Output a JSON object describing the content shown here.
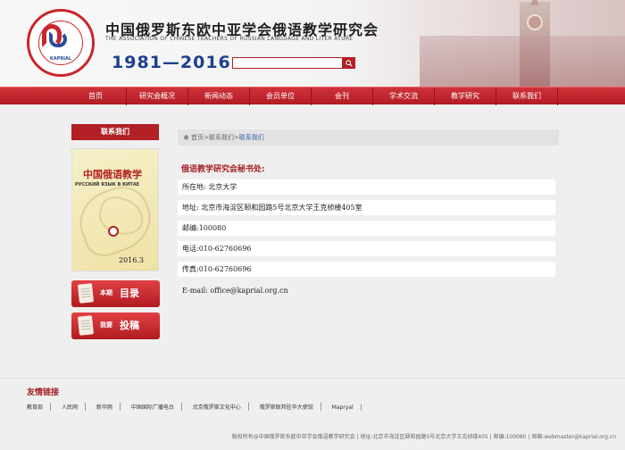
{
  "header": {
    "logo_text": "KAPRIAL",
    "title_cn": "中国俄罗斯东欧中亚学会俄语教学研究会",
    "title_en": "THE ASSOCIATION OF CHINESE TEACHERS OF RUSSIAN LANGUAGE AND LITER ATURE",
    "years": "1981—2016",
    "search": {
      "value": "",
      "placeholder": ""
    }
  },
  "nav": {
    "items": [
      {
        "label": "首页"
      },
      {
        "label": "研究会概况"
      },
      {
        "label": "新闻动态"
      },
      {
        "label": "会员单位"
      },
      {
        "label": "会刊"
      },
      {
        "label": "学术交流"
      },
      {
        "label": "教学研究"
      },
      {
        "label": "联系我们"
      }
    ]
  },
  "sidebar": {
    "title": "联系我们",
    "cover": {
      "title": "中国俄语教学",
      "subtitle": "РУССКИЙ ЯЗЫК В КИТАЕ",
      "date": "2016.3"
    },
    "btn_toc": {
      "small": "本期",
      "large": "目录"
    },
    "btn_submit": {
      "small": "我要",
      "large": "投稿"
    }
  },
  "breadcrumb": {
    "home": "首页",
    "sep1": ">",
    "section": "联系我们",
    "sep2": ">",
    "current": "联系我们"
  },
  "content": {
    "title": "俄语教学研究会秘书处:",
    "rows": [
      "所在地: 北京大学",
      "地址: 北京市海淀区颐和园路5号北京大学王克桢楼405室",
      "邮编:100080",
      "电话:010-62760696",
      "传真:010-62760696",
      "E-mail: office@kaprial.org.cn"
    ]
  },
  "footer": {
    "links_title": "友情链接",
    "links": [
      "教育部",
      "人民网",
      "新华网",
      "中国国际广播电台",
      "北京俄罗斯文化中心",
      "俄罗斯联邦驻华大使馆",
      "Mapryal"
    ],
    "copyright": "版权所有@中国俄罗斯东欧中亚学会俄语教学研究会 | 地址:北京市海淀区颐和园路5号北京大学王克桢楼405 | 邮编:100080 | 邮箱:webmaster@kaprial.org.cn"
  },
  "colors": {
    "brand_red": "#b21f24",
    "brand_blue": "#1d3f8f",
    "link_blue": "#3b62b0"
  }
}
